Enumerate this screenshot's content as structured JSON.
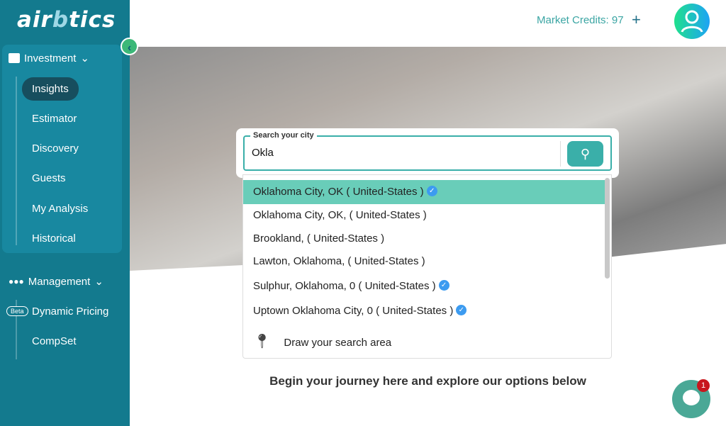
{
  "brand": {
    "logo": "airbtics",
    "logo_a": "air",
    "logo_b": "b",
    "logo_c": "tics"
  },
  "sidebar": {
    "investment": {
      "label": "Investment",
      "items": [
        {
          "label": "Insights",
          "active": true
        },
        {
          "label": "Estimator"
        },
        {
          "label": "Discovery"
        },
        {
          "label": "Guests"
        },
        {
          "label": "My Analysis"
        },
        {
          "label": "Historical"
        }
      ]
    },
    "management": {
      "label": "Management",
      "beta": "Beta",
      "items": [
        {
          "label": "Dynamic Pricing"
        },
        {
          "label": "CompSet"
        }
      ]
    }
  },
  "header": {
    "credits": "Market Credits: 97",
    "plus": "+"
  },
  "search": {
    "label": "Search your city",
    "value": "Okla",
    "options": [
      {
        "text": "Oklahoma City, OK ( United-States )",
        "verified": true
      },
      {
        "text": "Oklahoma City, OK, ( United-States )",
        "verified": false
      },
      {
        "text": "Brookland, ( United-States )",
        "verified": false
      },
      {
        "text": "Lawton, Oklahoma, ( United-States )",
        "verified": false
      },
      {
        "text": "Sulphur, Oklahoma, 0 ( United-States )",
        "verified": true
      },
      {
        "text": "Uptown Oklahoma City, 0 ( United-States )",
        "verified": true
      }
    ],
    "draw_area": "Draw your search area"
  },
  "tagline": "Begin your journey here and explore our options below",
  "chat": {
    "badge": "1"
  },
  "colors": {
    "sidebar": "#137a8e",
    "accent": "#3aafa9",
    "highlight": "#69cdb9",
    "verified": "#3c9bf0"
  }
}
